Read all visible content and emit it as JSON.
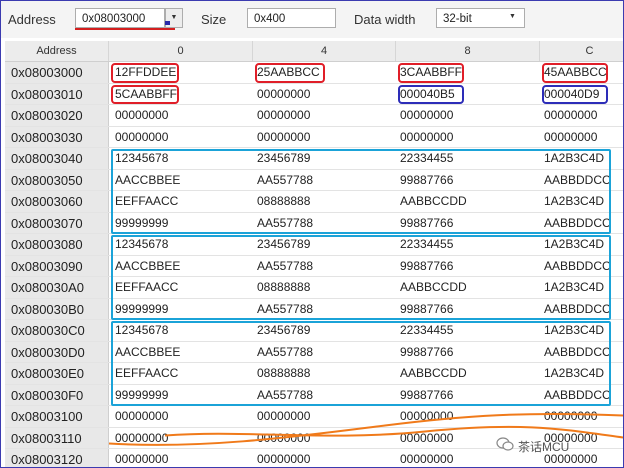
{
  "toolbar": {
    "address_label": "Address",
    "address_value": "0x08003000",
    "size_label": "Size",
    "size_value": "0x400",
    "width_label": "Data width",
    "width_value": "32-bit"
  },
  "columns": [
    "Address",
    "0",
    "4",
    "8",
    "C"
  ],
  "rows": [
    {
      "addr": "0x08003000",
      "cells": [
        "12FFDDEE",
        "25AABBCC",
        "3CAABBFF",
        "45AABBCC"
      ]
    },
    {
      "addr": "0x08003010",
      "cells": [
        "5CAABBFF",
        "00000000",
        "000040B5",
        "000040D9"
      ]
    },
    {
      "addr": "0x08003020",
      "cells": [
        "00000000",
        "00000000",
        "00000000",
        "00000000"
      ]
    },
    {
      "addr": "0x08003030",
      "cells": [
        "00000000",
        "00000000",
        "00000000",
        "00000000"
      ]
    },
    {
      "addr": "0x08003040",
      "cells": [
        "12345678",
        "23456789",
        "22334455",
        "1A2B3C4D"
      ]
    },
    {
      "addr": "0x08003050",
      "cells": [
        "AACCBBEE",
        "AA557788",
        "99887766",
        "AABBDDCC"
      ]
    },
    {
      "addr": "0x08003060",
      "cells": [
        "EEFFAACC",
        "08888888",
        "AABBCCDD",
        "1A2B3C4D"
      ]
    },
    {
      "addr": "0x08003070",
      "cells": [
        "99999999",
        "AA557788",
        "99887766",
        "AABBDDCC"
      ]
    },
    {
      "addr": "0x08003080",
      "cells": [
        "12345678",
        "23456789",
        "22334455",
        "1A2B3C4D"
      ]
    },
    {
      "addr": "0x08003090",
      "cells": [
        "AACCBBEE",
        "AA557788",
        "99887766",
        "AABBDDCC"
      ]
    },
    {
      "addr": "0x080030A0",
      "cells": [
        "EEFFAACC",
        "08888888",
        "AABBCCDD",
        "1A2B3C4D"
      ]
    },
    {
      "addr": "0x080030B0",
      "cells": [
        "99999999",
        "AA557788",
        "99887766",
        "AABBDDCC"
      ]
    },
    {
      "addr": "0x080030C0",
      "cells": [
        "12345678",
        "23456789",
        "22334455",
        "1A2B3C4D"
      ]
    },
    {
      "addr": "0x080030D0",
      "cells": [
        "AACCBBEE",
        "AA557788",
        "99887766",
        "AABBDDCC"
      ]
    },
    {
      "addr": "0x080030E0",
      "cells": [
        "EEFFAACC",
        "08888888",
        "AABBCCDD",
        "1A2B3C4D"
      ]
    },
    {
      "addr": "0x080030F0",
      "cells": [
        "99999999",
        "AA557788",
        "99887766",
        "AABBDDCC"
      ]
    },
    {
      "addr": "0x08003100",
      "cells": [
        "00000000",
        "00000000",
        "00000000",
        "00000000"
      ]
    },
    {
      "addr": "0x08003110",
      "cells": [
        "00000000",
        "00000000",
        "00000000",
        "00000000"
      ]
    },
    {
      "addr": "0x08003120",
      "cells": [
        "00000000",
        "00000000",
        "00000000",
        "00000000"
      ]
    }
  ],
  "highlights": {
    "red": [
      [
        0,
        0
      ],
      [
        0,
        1
      ],
      [
        0,
        2
      ],
      [
        0,
        3
      ],
      [
        1,
        0
      ]
    ],
    "navy": [
      [
        1,
        2
      ],
      [
        1,
        3
      ]
    ],
    "cyan_groups": [
      [
        4,
        7
      ],
      [
        8,
        11
      ],
      [
        12,
        15
      ]
    ]
  },
  "colors": {
    "red": "#e01e28",
    "navy": "#2d2db8",
    "cyan": "#1ba3d8",
    "wave": "#f07a1a"
  },
  "watermark": {
    "icon": "wechat-icon",
    "text": "茶话MCU"
  }
}
